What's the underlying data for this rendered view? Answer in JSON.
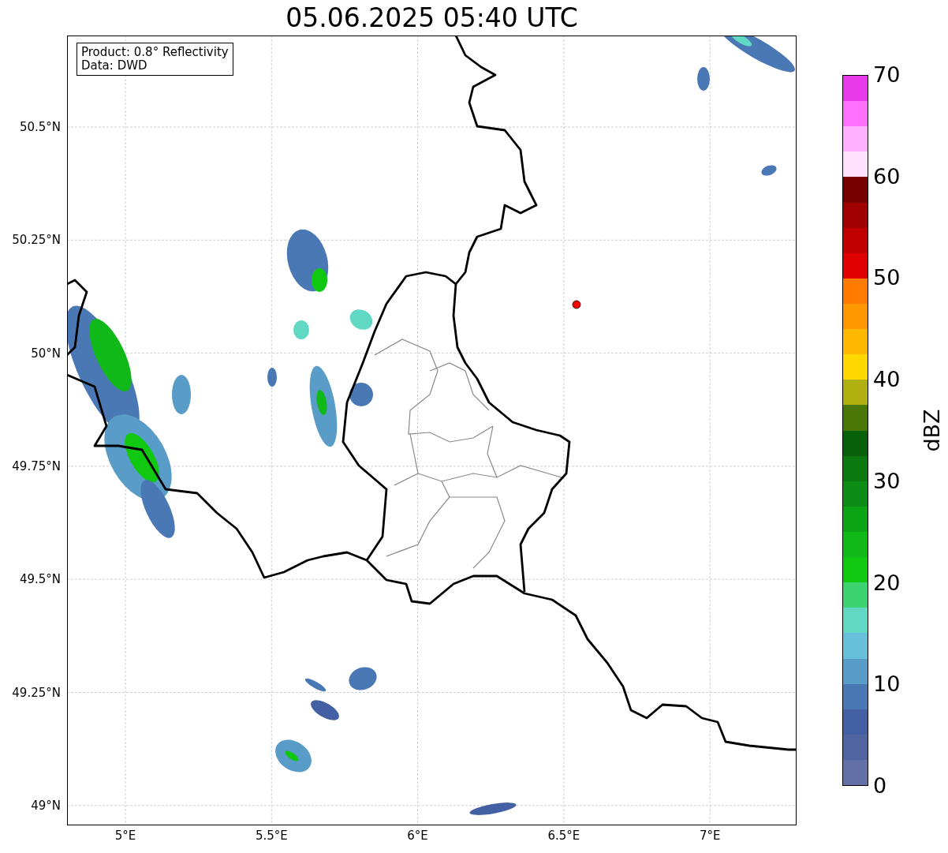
{
  "title": "05.06.2025 05:40 UTC",
  "info_box": [
    "Product: 0.8° Reflectivity",
    "Data: DWD"
  ],
  "map": {
    "lat_ticks": [
      "50.5°N",
      "50.25°N",
      "50°N",
      "49.75°N",
      "49.5°N",
      "49.25°N",
      "49°N"
    ],
    "lon_ticks": [
      "5°E",
      "5.5°E",
      "6°E",
      "6.5°E",
      "7°E"
    ]
  },
  "colorbar": {
    "label": "dBZ",
    "ticks": [
      "70",
      "60",
      "50",
      "40",
      "30",
      "20",
      "10",
      "0"
    ],
    "bands": [
      {
        "color": "#6370a8"
      },
      {
        "color": "#5064a0"
      },
      {
        "color": "#4460a4"
      },
      {
        "color": "#4a78b4"
      },
      {
        "color": "#5a9cc8"
      },
      {
        "color": "#66c0dc"
      },
      {
        "color": "#60d8c4"
      },
      {
        "color": "#3cd470"
      },
      {
        "color": "#10c810"
      },
      {
        "color": "#10b818"
      },
      {
        "color": "#0ca414"
      },
      {
        "color": "#0c8c14"
      },
      {
        "color": "#0c7810"
      },
      {
        "color": "#086008"
      },
      {
        "color": "#4a7808"
      },
      {
        "color": "#b0b010"
      },
      {
        "color": "#ffd800"
      },
      {
        "color": "#ffb800"
      },
      {
        "color": "#ff9800"
      },
      {
        "color": "#ff7c00"
      },
      {
        "color": "#e00000"
      },
      {
        "color": "#c00000"
      },
      {
        "color": "#a00000"
      },
      {
        "color": "#780000"
      },
      {
        "color": "#ffe0ff"
      },
      {
        "color": "#ffb0ff"
      },
      {
        "color": "#ff70ff"
      },
      {
        "color": "#e838e8"
      }
    ]
  }
}
